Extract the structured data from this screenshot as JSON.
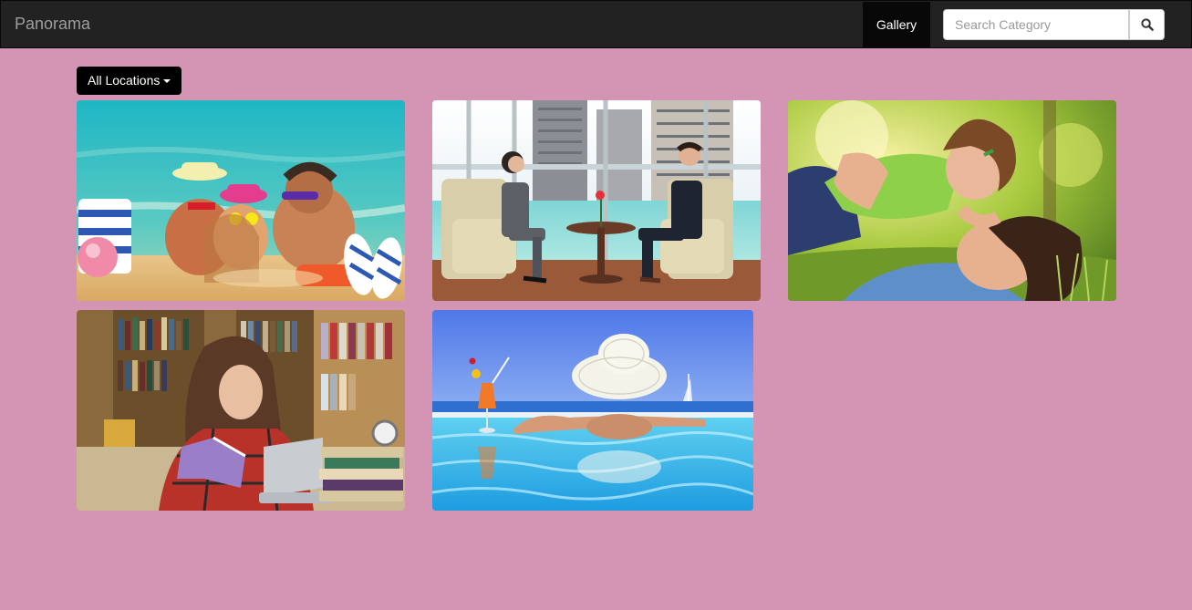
{
  "navbar": {
    "brand": "Panorama",
    "gallery_label": "Gallery",
    "search": {
      "placeholder": "Search Category",
      "value": ""
    },
    "search_icon": "search-icon"
  },
  "filter": {
    "location_label": "All Locations",
    "caret_icon": "caret-down-icon"
  },
  "gallery": {
    "images": [
      {
        "name": "gallery-image-beach-family",
        "subject": "family lying on beach"
      },
      {
        "name": "gallery-image-business-meeting",
        "subject": "business meeting in lounge"
      },
      {
        "name": "gallery-image-mother-child",
        "subject": "mother lifting child in park"
      },
      {
        "name": "gallery-image-reading-library",
        "subject": "woman reading in library"
      },
      {
        "name": "gallery-image-pool-sea",
        "subject": "woman with hat in infinity pool"
      }
    ]
  }
}
